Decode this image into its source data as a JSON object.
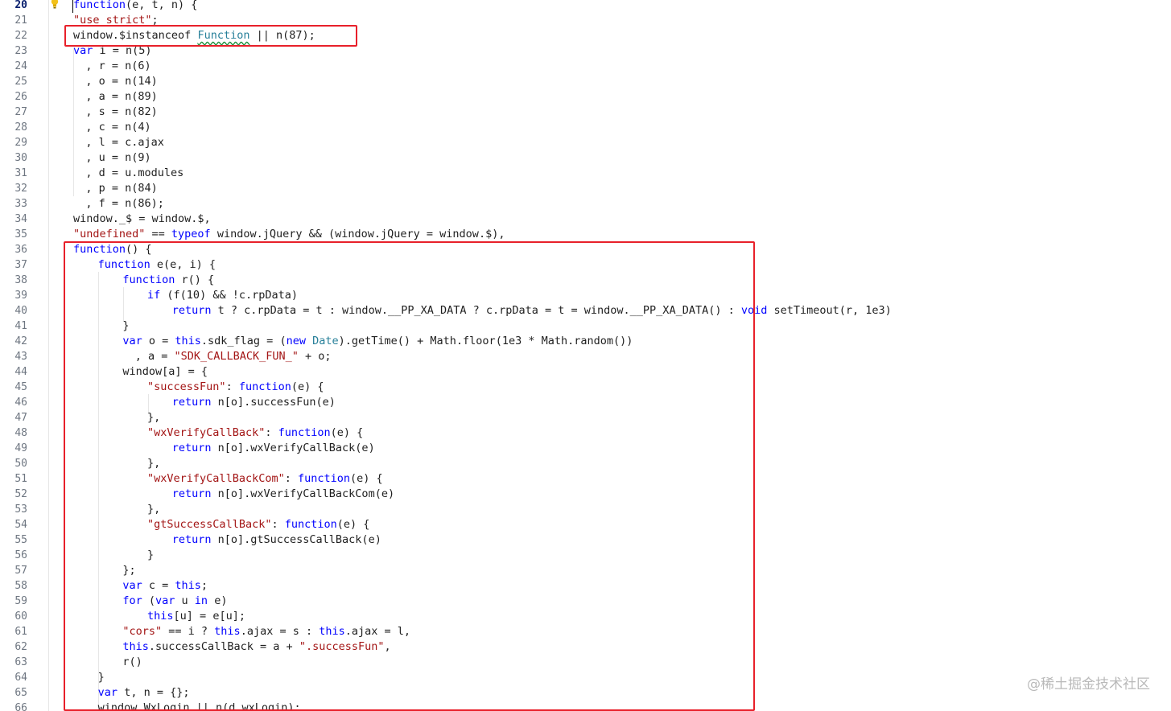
{
  "editor": {
    "line_numbers": [
      "20",
      "21",
      "22",
      "23",
      "24",
      "25",
      "26",
      "27",
      "28",
      "29",
      "30",
      "31",
      "32",
      "33",
      "34",
      "35",
      "36",
      "37",
      "38",
      "39",
      "40",
      "41",
      "42",
      "43",
      "44",
      "45",
      "46",
      "47",
      "48",
      "49",
      "50",
      "51",
      "52",
      "53",
      "54",
      "55",
      "56",
      "57",
      "58",
      "59",
      "60",
      "61",
      "62",
      "63",
      "64",
      "65",
      "66"
    ],
    "active_line": "20",
    "lines": [
      {
        "indent": 0,
        "tokens": [
          [
            "kw",
            "function"
          ],
          [
            "p",
            "(e, t, n) {"
          ]
        ]
      },
      {
        "indent": 0,
        "tokens": [
          [
            "str",
            "\"use strict\""
          ],
          [
            "p",
            ";"
          ]
        ]
      },
      {
        "indent": 0,
        "tokens": [
          [
            "p",
            "window.$instanceof "
          ],
          [
            "type",
            "Function"
          ],
          [
            "p",
            " || n(87);"
          ]
        ]
      },
      {
        "indent": 0,
        "tokens": [
          [
            "kw",
            "var"
          ],
          [
            "p",
            " i = n(5)"
          ]
        ]
      },
      {
        "indent": 2,
        "tokens": [
          [
            "p",
            ", r = n(6)"
          ]
        ]
      },
      {
        "indent": 2,
        "tokens": [
          [
            "p",
            ", o = n(14)"
          ]
        ]
      },
      {
        "indent": 2,
        "tokens": [
          [
            "p",
            ", a = n(89)"
          ]
        ]
      },
      {
        "indent": 2,
        "tokens": [
          [
            "p",
            ", s = n(82)"
          ]
        ]
      },
      {
        "indent": 2,
        "tokens": [
          [
            "p",
            ", c = n(4)"
          ]
        ]
      },
      {
        "indent": 2,
        "tokens": [
          [
            "p",
            ", l = c.ajax"
          ]
        ]
      },
      {
        "indent": 2,
        "tokens": [
          [
            "p",
            ", u = n(9)"
          ]
        ]
      },
      {
        "indent": 2,
        "tokens": [
          [
            "p",
            ", d = u.modules"
          ]
        ]
      },
      {
        "indent": 2,
        "tokens": [
          [
            "p",
            ", p = n(84)"
          ]
        ]
      },
      {
        "indent": 2,
        "tokens": [
          [
            "p",
            ", f = n(86);"
          ]
        ]
      },
      {
        "indent": 0,
        "tokens": [
          [
            "p",
            "window._$ = window.$,"
          ]
        ]
      },
      {
        "indent": 0,
        "tokens": [
          [
            "str",
            "\"undefined\""
          ],
          [
            "p",
            " == "
          ],
          [
            "kw",
            "typeof"
          ],
          [
            "p",
            " window.jQuery && (window.jQuery = window.$),"
          ]
        ]
      },
      {
        "indent": 0,
        "tokens": [
          [
            "kw",
            "function"
          ],
          [
            "p",
            "() {"
          ]
        ]
      },
      {
        "indent": 4,
        "tokens": [
          [
            "kw",
            "function"
          ],
          [
            "p",
            " e(e, i) {"
          ]
        ]
      },
      {
        "indent": 8,
        "tokens": [
          [
            "kw",
            "function"
          ],
          [
            "p",
            " r() {"
          ]
        ]
      },
      {
        "indent": 12,
        "tokens": [
          [
            "kw",
            "if"
          ],
          [
            "p",
            " (f(10) && !c.rpData)"
          ]
        ]
      },
      {
        "indent": 16,
        "tokens": [
          [
            "kw",
            "return"
          ],
          [
            "p",
            " t ? c.rpData = t : window.__PP_XA_DATA ? c.rpData = t = window.__PP_XA_DATA() : "
          ],
          [
            "kw",
            "void"
          ],
          [
            "p",
            " setTimeout(r, 1e3)"
          ]
        ]
      },
      {
        "indent": 8,
        "tokens": [
          [
            "p",
            "}"
          ]
        ]
      },
      {
        "indent": 8,
        "tokens": [
          [
            "kw",
            "var"
          ],
          [
            "p",
            " o = "
          ],
          [
            "kw",
            "this"
          ],
          [
            "p",
            ".sdk_flag = ("
          ],
          [
            "kw",
            "new"
          ],
          [
            "p",
            " "
          ],
          [
            "type",
            "Date"
          ],
          [
            "p",
            ").getTime() + Math.floor(1e3 * Math.random())"
          ]
        ]
      },
      {
        "indent": 10,
        "tokens": [
          [
            "p",
            ", a = "
          ],
          [
            "str",
            "\"SDK_CALLBACK_FUN_\""
          ],
          [
            "p",
            " + o;"
          ]
        ]
      },
      {
        "indent": 8,
        "tokens": [
          [
            "p",
            "window[a] = {"
          ]
        ]
      },
      {
        "indent": 12,
        "tokens": [
          [
            "str",
            "\"successFun\""
          ],
          [
            "p",
            ": "
          ],
          [
            "kw",
            "function"
          ],
          [
            "p",
            "(e) {"
          ]
        ]
      },
      {
        "indent": 16,
        "tokens": [
          [
            "kw",
            "return"
          ],
          [
            "p",
            " n[o].successFun(e)"
          ]
        ]
      },
      {
        "indent": 12,
        "tokens": [
          [
            "p",
            "},"
          ]
        ]
      },
      {
        "indent": 12,
        "tokens": [
          [
            "str",
            "\"wxVerifyCallBack\""
          ],
          [
            "p",
            ": "
          ],
          [
            "kw",
            "function"
          ],
          [
            "p",
            "(e) {"
          ]
        ]
      },
      {
        "indent": 16,
        "tokens": [
          [
            "kw",
            "return"
          ],
          [
            "p",
            " n[o].wxVerifyCallBack(e)"
          ]
        ]
      },
      {
        "indent": 12,
        "tokens": [
          [
            "p",
            "},"
          ]
        ]
      },
      {
        "indent": 12,
        "tokens": [
          [
            "str",
            "\"wxVerifyCallBackCom\""
          ],
          [
            "p",
            ": "
          ],
          [
            "kw",
            "function"
          ],
          [
            "p",
            "(e) {"
          ]
        ]
      },
      {
        "indent": 16,
        "tokens": [
          [
            "kw",
            "return"
          ],
          [
            "p",
            " n[o].wxVerifyCallBackCom(e)"
          ]
        ]
      },
      {
        "indent": 12,
        "tokens": [
          [
            "p",
            "},"
          ]
        ]
      },
      {
        "indent": 12,
        "tokens": [
          [
            "str",
            "\"gtSuccessCallBack\""
          ],
          [
            "p",
            ": "
          ],
          [
            "kw",
            "function"
          ],
          [
            "p",
            "(e) {"
          ]
        ]
      },
      {
        "indent": 16,
        "tokens": [
          [
            "kw",
            "return"
          ],
          [
            "p",
            " n[o].gtSuccessCallBack(e)"
          ]
        ]
      },
      {
        "indent": 12,
        "tokens": [
          [
            "p",
            "}"
          ]
        ]
      },
      {
        "indent": 8,
        "tokens": [
          [
            "p",
            "};"
          ]
        ]
      },
      {
        "indent": 8,
        "tokens": [
          [
            "kw",
            "var"
          ],
          [
            "p",
            " c = "
          ],
          [
            "kw",
            "this"
          ],
          [
            "p",
            ";"
          ]
        ]
      },
      {
        "indent": 8,
        "tokens": [
          [
            "kw",
            "for"
          ],
          [
            "p",
            " ("
          ],
          [
            "kw",
            "var"
          ],
          [
            "p",
            " u "
          ],
          [
            "kw",
            "in"
          ],
          [
            "p",
            " e)"
          ]
        ]
      },
      {
        "indent": 12,
        "tokens": [
          [
            "kw",
            "this"
          ],
          [
            "p",
            "[u] = e[u];"
          ]
        ]
      },
      {
        "indent": 8,
        "tokens": [
          [
            "str",
            "\"cors\""
          ],
          [
            "p",
            " == i ? "
          ],
          [
            "kw",
            "this"
          ],
          [
            "p",
            ".ajax = s : "
          ],
          [
            "kw",
            "this"
          ],
          [
            "p",
            ".ajax = l,"
          ]
        ]
      },
      {
        "indent": 8,
        "tokens": [
          [
            "kw",
            "this"
          ],
          [
            "p",
            ".successCallBack = a + "
          ],
          [
            "str",
            "\".successFun\""
          ],
          [
            "p",
            ","
          ]
        ]
      },
      {
        "indent": 8,
        "tokens": [
          [
            "p",
            "r()"
          ]
        ]
      },
      {
        "indent": 4,
        "tokens": [
          [
            "p",
            "}"
          ]
        ]
      },
      {
        "indent": 4,
        "tokens": [
          [
            "kw",
            "var"
          ],
          [
            "p",
            " t, n = {};"
          ]
        ]
      },
      {
        "indent": 4,
        "tokens": [
          [
            "p",
            "window.WxLogin || n(d.wxLogin);"
          ]
        ]
      }
    ]
  },
  "watermark": "@稀土掘金技术社区",
  "colors": {
    "highlight_box": "#e8202a",
    "keyword": "#0000ff",
    "string": "#a31515",
    "type": "#267f99"
  },
  "icons": {
    "lightbulb": "lightbulb-icon"
  }
}
